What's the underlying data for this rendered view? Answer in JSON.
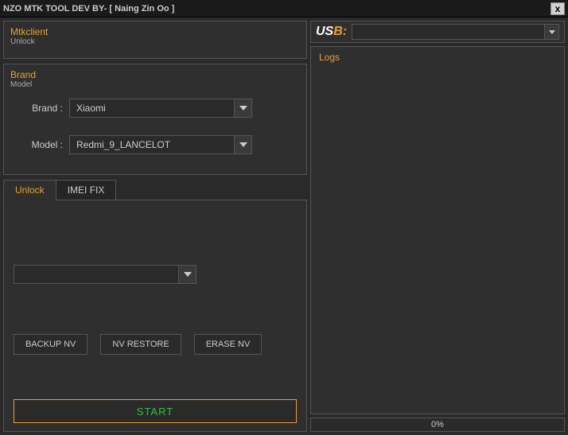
{
  "title": "NZO MTK TOOL DEV BY- [ Naing Zin Oo ]",
  "close": "x",
  "mtk": {
    "label": "Mtkclient",
    "sub": "Unlock"
  },
  "brand": {
    "label": "Brand",
    "sub": "Model",
    "brand_label": "Brand :",
    "brand_value": "Xiaomi",
    "model_label": "Model :",
    "model_value": "Redmi_9_LANCELOT"
  },
  "tabs": {
    "unlock": "Unlock",
    "imei": "IMEI FIX"
  },
  "actions": {
    "select_value": "",
    "backup": "BACKUP NV",
    "restore": "NV RESTORE",
    "erase": "ERASE NV",
    "start": "START"
  },
  "usb": {
    "us": "US",
    "b": "B:",
    "value": ""
  },
  "logs": {
    "title": "Logs"
  },
  "progress": {
    "text": "0%"
  }
}
